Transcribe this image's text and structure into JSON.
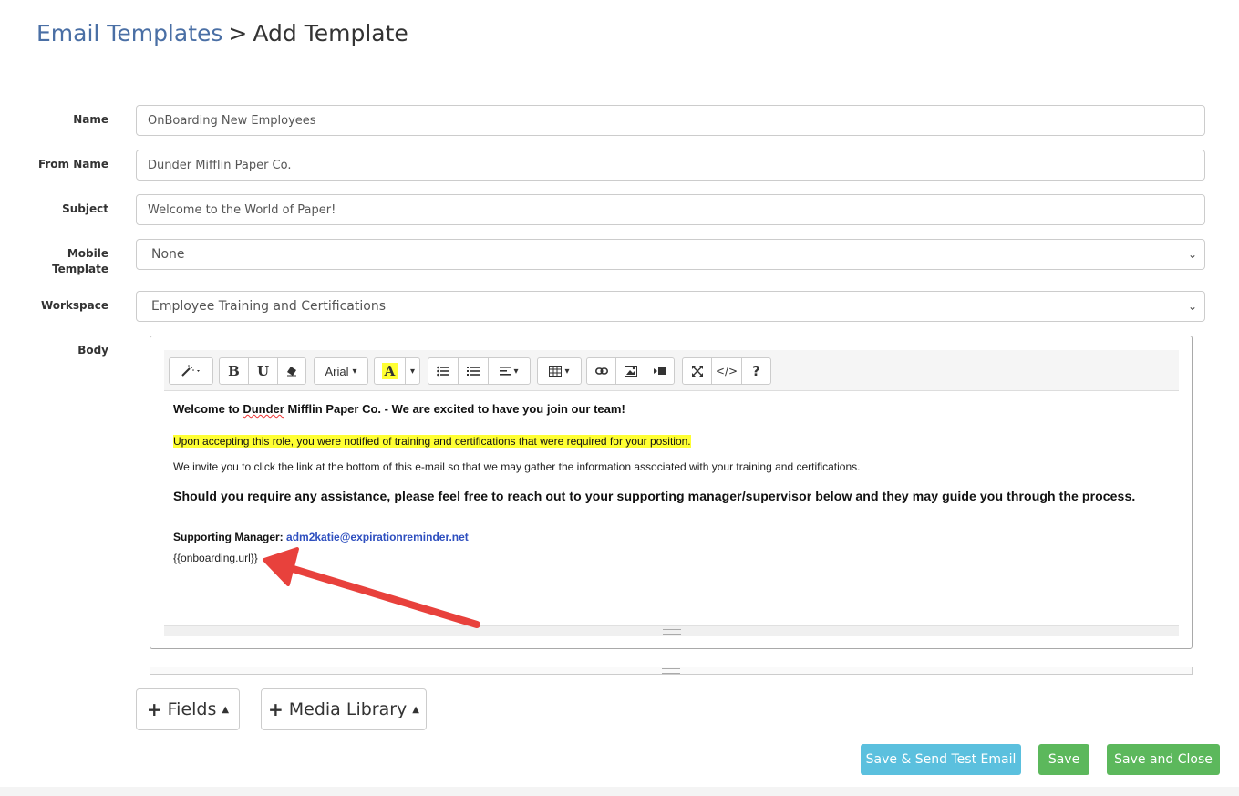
{
  "breadcrumb": {
    "parent": "Email Templates",
    "separator": ">",
    "current": "Add Template"
  },
  "form": {
    "name_label": "Name",
    "name_value": "OnBoarding New Employees",
    "from_label": "From Name",
    "from_value": "Dunder Mifflin Paper Co.",
    "subject_label": "Subject",
    "subject_value": "Welcome to the World of Paper!",
    "mobile_label_1": "Mobile",
    "mobile_label_2": "Template",
    "mobile_value": "None",
    "workspace_label": "Workspace",
    "workspace_value": "Employee Training and Certifications",
    "body_label": "Body"
  },
  "toolbar": {
    "font_name": "Arial",
    "bold": "B",
    "underline": "U",
    "code": "</>",
    "help": "?"
  },
  "body": {
    "line1_pre": "Welcome to ",
    "line1_squig": "Dunder",
    "line1_post": " Mifflin Paper Co. - We are excited to have you join our team!",
    "highlight": "Upon accepting this role, you were notified of training and certifications that were required for your position.",
    "invite": "We invite you to click the link at the bottom of this e-mail so that we may gather the information associated with your training and certifications.",
    "assist": "Should you require any assistance, please feel free to reach out to your supporting manager/supervisor below and they may guide you through the process.",
    "manager_label": "Supporting Manager:",
    "manager_email": "adm2katie@expirationreminder.net",
    "url_token": "{{onboarding.url}}"
  },
  "buttons": {
    "fields": "Fields",
    "media": "Media Library",
    "test_email": "Save & Send Test Email",
    "save": "Save",
    "save_close": "Save and Close"
  },
  "colors": {
    "link": "#4a6fa5",
    "highlight": "#ffff33",
    "annotation_arrow": "#e8413c",
    "info_button": "#5bc0de",
    "success_button": "#5cb85c",
    "email_link": "#2e4fbf"
  }
}
